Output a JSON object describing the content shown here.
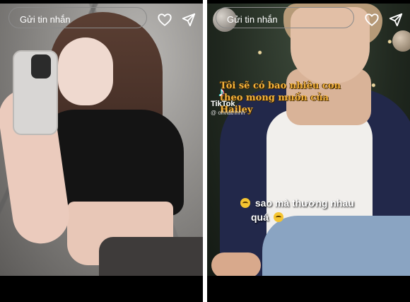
{
  "stories": [
    {
      "reply_placeholder": "Gửi tin nhắn",
      "like_icon": "heart-icon",
      "send_icon": "send-icon"
    },
    {
      "caption_top": "Tôi sẽ có bao nhiêu con theo mong muốn của Hailey",
      "tiktok_label": "TikTok",
      "tiktok_user": "@ oliviatrinhh",
      "caption_bottom_line1": "sao mà thương nhau",
      "caption_bottom_line2": "quá",
      "reply_placeholder": "Gửi tin nhắn",
      "like_icon": "heart-icon",
      "send_icon": "send-icon"
    }
  ],
  "colors": {
    "caption_top": "#f3b23c",
    "background": "#000000",
    "text": "#ffffff"
  }
}
